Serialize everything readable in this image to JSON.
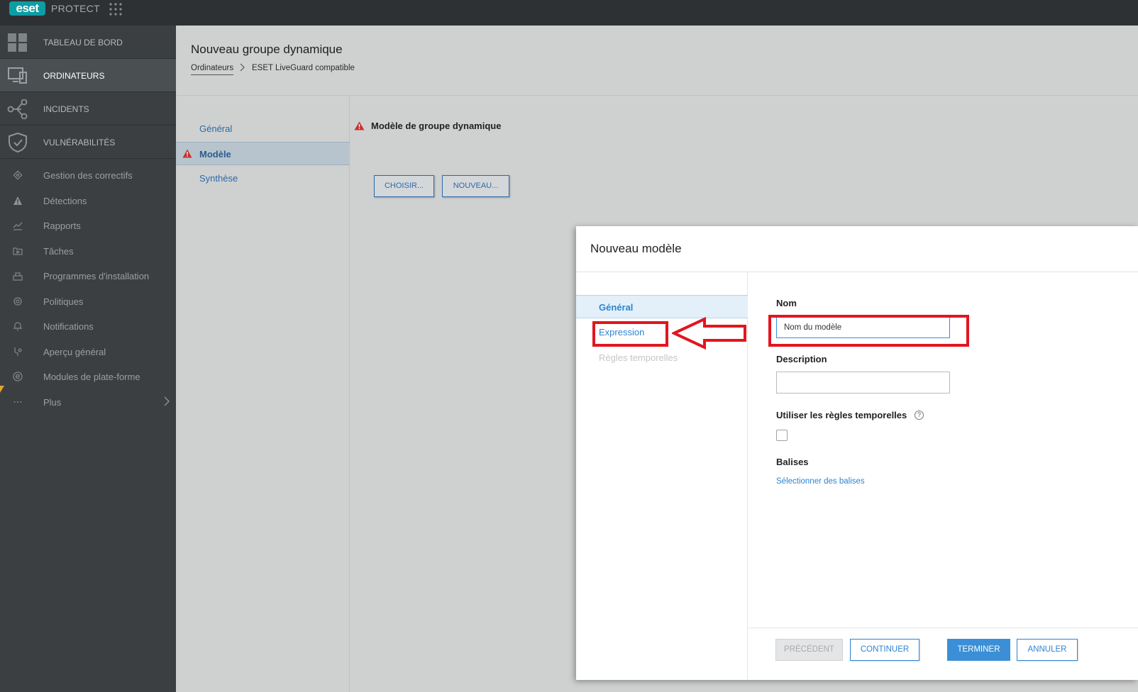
{
  "topbar": {
    "logo": "eset",
    "product": "PROTECT",
    "apps_icon": "grid-dots-icon"
  },
  "sidebar": {
    "main_items": [
      {
        "label": "TABLEAU DE BORD",
        "icon": "dashboard-icon"
      },
      {
        "label": "ORDINATEURS",
        "icon": "computers-icon",
        "active": true
      },
      {
        "label": "INCIDENTS",
        "icon": "incidents-icon"
      },
      {
        "label": "VULNÉRABILITÉS",
        "icon": "shield-icon"
      }
    ],
    "sub_items": [
      {
        "label": "Gestion des correctifs",
        "icon": "patch-icon"
      },
      {
        "label": "Détections",
        "icon": "warning-icon"
      },
      {
        "label": "Rapports",
        "icon": "chart-icon"
      },
      {
        "label": "Tâches",
        "icon": "tasks-icon"
      },
      {
        "label": "Programmes d'installation",
        "icon": "installer-icon"
      },
      {
        "label": "Politiques",
        "icon": "gear-icon"
      },
      {
        "label": "Notifications",
        "icon": "bell-icon"
      },
      {
        "label": "Aperçu général",
        "icon": "overview-icon"
      },
      {
        "label": "Modules de plate-forme",
        "icon": "module-icon"
      },
      {
        "label": "Plus",
        "icon": "more-icon"
      }
    ]
  },
  "header": {
    "title": "Nouveau groupe dynamique",
    "breadcrumb": [
      "Ordinateurs",
      "ESET LiveGuard compatible"
    ]
  },
  "steps": [
    {
      "label": "Général"
    },
    {
      "label": "Modèle",
      "active": true,
      "warning": true
    },
    {
      "label": "Synthèse"
    }
  ],
  "content": {
    "section_title": "Modèle de groupe dynamique",
    "choose_button": "CHOISIR...",
    "new_button": "NOUVEAU..."
  },
  "modal": {
    "title": "Nouveau modèle",
    "nav": [
      {
        "label": "Général",
        "state": "active"
      },
      {
        "label": "Expression",
        "state": "link"
      },
      {
        "label": "Règles temporelles",
        "state": "disabled"
      }
    ],
    "name_label": "Nom",
    "name_value": "Nom du modèle",
    "description_label": "Description",
    "description_value": "",
    "temporal_label": "Utiliser les règles temporelles",
    "temporal_checked": false,
    "tags_label": "Balises",
    "tags_link": "Sélectionner des balises",
    "buttons": {
      "previous": "PRÉCÉDENT",
      "continue": "CONTINUER",
      "finish": "TERMINER",
      "cancel": "ANNULER"
    }
  },
  "colors": {
    "annotation_red": "#e1161f",
    "accent_blue": "#3a8fd6",
    "sidebar_bg": "#3b3f41",
    "topbar_bg": "#2e3133",
    "brand_teal": "#0d9da4"
  }
}
